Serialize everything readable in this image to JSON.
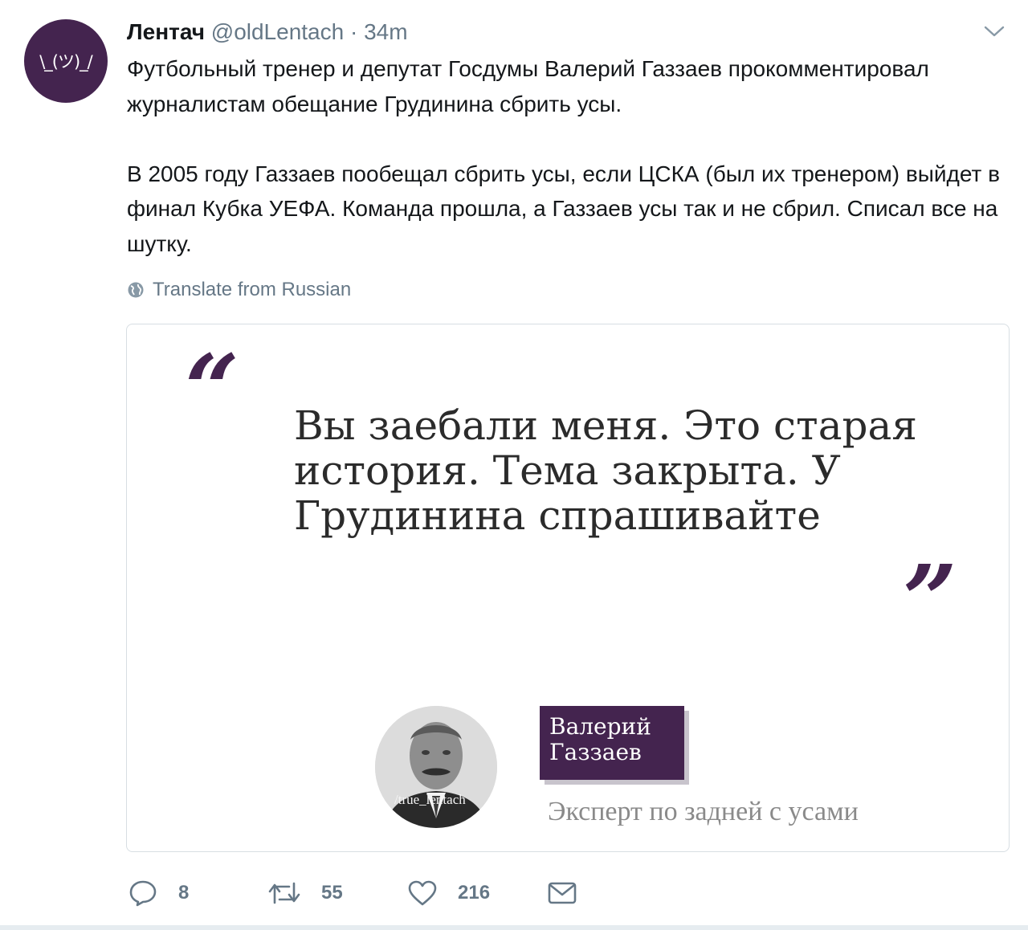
{
  "tweet": {
    "author_name": "Лентач",
    "author_handle": "@oldLentach",
    "separator": "·",
    "time": "34m",
    "avatar_text": "\\_(ツ)_/",
    "paragraphs": [
      "Футбольный тренер и депутат Госдумы Валерий Газзаев прокомментировал журналистам обещание Грудинина сбрить усы.",
      "В 2005 году Газзаев пообещал сбрить усы, если ЦСКА (был их тренером) выйдет в финал Кубка УЕФА. Команда прошла, а Газзаев усы так и не сбрил. Списал все на шутку."
    ],
    "translate_label": "Translate from Russian"
  },
  "card": {
    "open_quote": "“",
    "close_quote": "”",
    "quote_text": "Вы заебали меня. Это старая история. Тема закрыта. У Грудинина спрашивайте",
    "person_first": "Валерий",
    "person_last": "Газзаев",
    "person_title": "Эксперт по задней с усами",
    "watermark": "/true_lentach",
    "accent_color": "#44244f"
  },
  "actions": {
    "replies": "8",
    "retweets": "55",
    "likes": "216"
  }
}
